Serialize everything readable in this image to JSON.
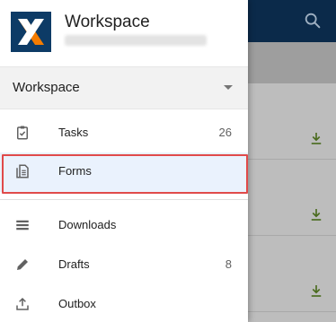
{
  "header": {
    "title": "Workspace"
  },
  "workspace_selector": {
    "selected": "Workspace"
  },
  "nav": {
    "tasks": {
      "label": "Tasks",
      "count": "26"
    },
    "forms": {
      "label": "Forms"
    },
    "downloads": {
      "label": "Downloads"
    },
    "drafts": {
      "label": "Drafts",
      "count": "8"
    },
    "outbox": {
      "label": "Outbox"
    }
  },
  "colors": {
    "app_bar": "#0b2a4a",
    "logo_bg": "#0d3b66",
    "logo_x_orange": "#f57c00",
    "logo_x_white": "#ffffff",
    "selection_bg": "#eaf2fd",
    "highlight_border": "#e04a4a",
    "download_icon": "#4a6b1e"
  },
  "icons": {
    "search": "search-icon",
    "tasks": "clipboard-check-icon",
    "forms": "document-icon",
    "downloads": "list-icon",
    "drafts": "pencil-icon",
    "outbox": "upload-icon",
    "dropdown": "caret-down-icon",
    "download": "download-icon"
  }
}
